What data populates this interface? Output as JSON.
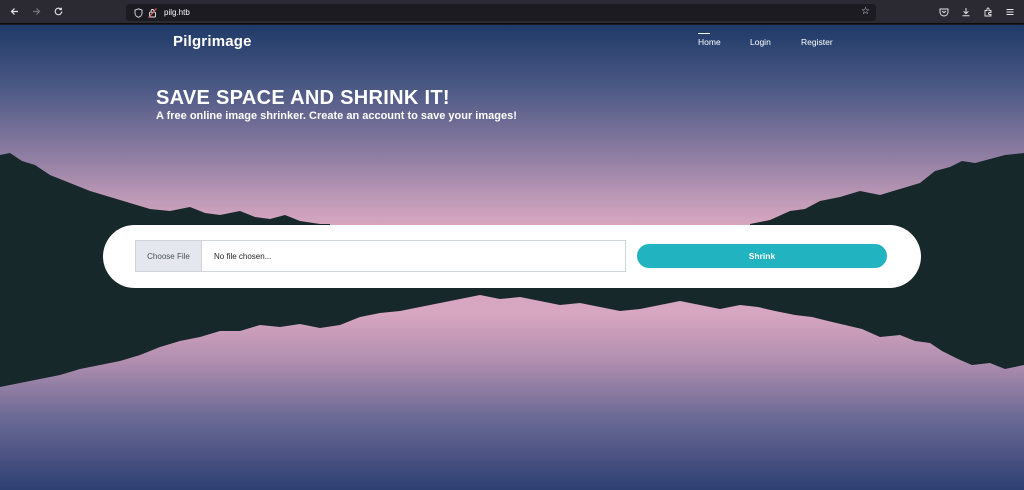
{
  "browser": {
    "url": "pilg.htb",
    "back_icon": "arrow-left",
    "forward_icon": "arrow-right",
    "reload_icon": "reload",
    "tools": [
      "pocket-icon",
      "download-icon",
      "extensions-icon",
      "menu-icon"
    ]
  },
  "site": {
    "brand": "Pilgrimage",
    "nav": {
      "home": "Home",
      "login": "Login",
      "register": "Register"
    },
    "hero": {
      "title": "SAVE SPACE AND SHRINK IT!",
      "subtitle": "A free online image shrinker. Create an account to save your images!"
    },
    "upload": {
      "choose_label": "Choose File",
      "file_placeholder": "No file chosen...",
      "shrink_label": "Shrink"
    }
  },
  "colors": {
    "accent": "#22b3c1",
    "mountain": "#17282a"
  }
}
